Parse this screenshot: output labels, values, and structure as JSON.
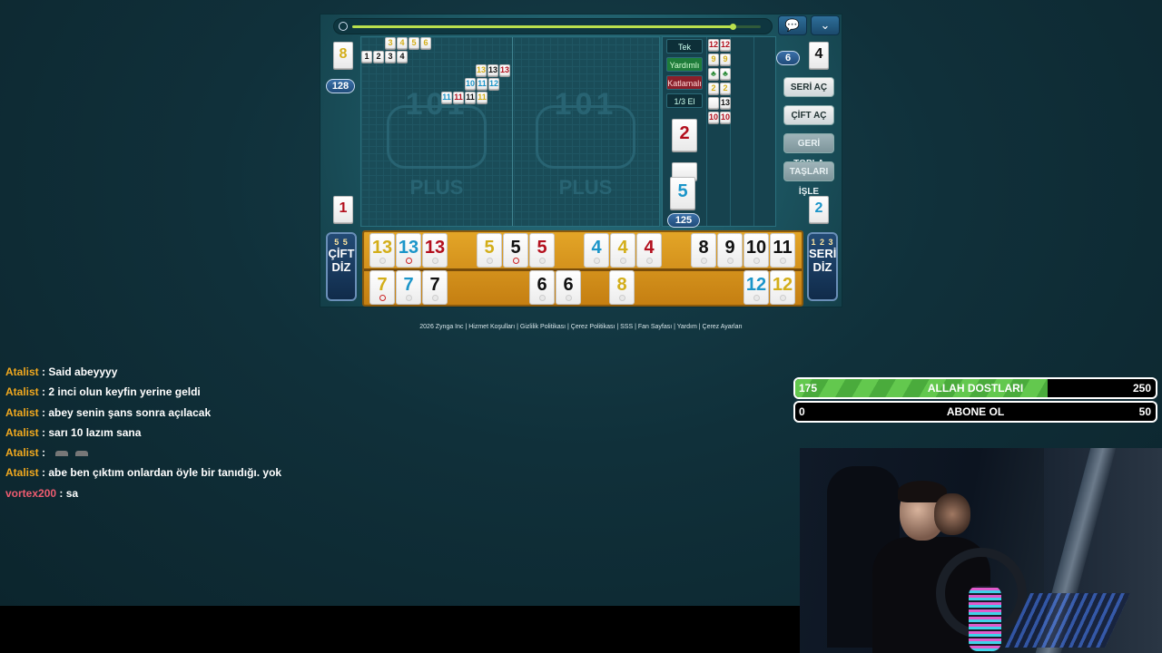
{
  "game": {
    "left_indicator_top": "8",
    "left_count": "128",
    "left_indicator_bottom": "1",
    "right_count": "6",
    "right_indicator_top": "4",
    "right_indicator_bottom": "2",
    "deck_count": "125",
    "discard_tile": "2",
    "held_tile": "5",
    "progress": 0.93,
    "logo_text": "101",
    "logo_sub": "PLUS",
    "indicators": [
      "Tek",
      "Yardımlı",
      "Katlamalı",
      "1/3 El"
    ],
    "buttons": {
      "seri_ac": "SERİ AÇ",
      "cift_ac": "ÇİFT AÇ",
      "geri_topla": "GERİ TOPLA",
      "taslari_isle": "TAŞLARI İŞLE",
      "cift_diz_1": "ÇİFT",
      "cift_diz_2": "DİZ",
      "seri_diz_1": "SERİ",
      "seri_diz_2": "DİZ",
      "cards_left": "5 5",
      "cards_right": "1 2 3"
    },
    "rack_top": [
      {
        "n": "13",
        "c": "y"
      },
      {
        "n": "13",
        "c": "b",
        "dot": true
      },
      {
        "n": "13",
        "c": "r"
      },
      {
        "n": "5",
        "c": "y"
      },
      {
        "n": "5",
        "c": "k",
        "dot": true
      },
      {
        "n": "5",
        "c": "r"
      },
      {
        "n": "4",
        "c": "b"
      },
      {
        "n": "4",
        "c": "y"
      },
      {
        "n": "4",
        "c": "r"
      },
      {
        "n": "8",
        "c": "k"
      },
      {
        "n": "9",
        "c": "k"
      },
      {
        "n": "10",
        "c": "k"
      },
      {
        "n": "11",
        "c": "k"
      }
    ],
    "rack_bottom": [
      {
        "n": "7",
        "c": "y",
        "dot": true
      },
      {
        "n": "7",
        "c": "b"
      },
      {
        "n": "7",
        "c": "k"
      },
      {
        "n": "6",
        "c": "k"
      },
      {
        "n": "6",
        "c": "k"
      },
      {
        "n": "8",
        "c": "y"
      },
      {
        "n": "12",
        "c": "b"
      },
      {
        "n": "12",
        "c": "y"
      }
    ],
    "table_sets": [
      [
        "3",
        "4",
        "5",
        "6"
      ],
      [
        "1",
        "2",
        "3",
        "4"
      ],
      [
        "13",
        "13",
        "13"
      ],
      [
        "10",
        "11",
        "12"
      ],
      [
        "11",
        "11",
        "11",
        "11"
      ]
    ],
    "discard_columns": [
      [
        "12",
        "9",
        "♣",
        "2",
        "",
        "10"
      ],
      [
        "12",
        "9",
        "♣",
        "2",
        "13",
        "10"
      ]
    ]
  },
  "footer": "2026 Zynga Inc | Hizmet Koşulları | Gizlilik Politikası | Çerez Politikası | SSS | Fan Sayfası | Yardım | Çerez Ayarları",
  "chat": [
    {
      "user": "Atalist",
      "text": "Said abeyyyy"
    },
    {
      "user": "Atalist",
      "text": "2 inci olun keyfin yerine geldi"
    },
    {
      "user": "Atalist",
      "text": "abey senin şans sonra açılacak"
    },
    {
      "user": "Atalist",
      "text": "sarı 10 lazım sana"
    },
    {
      "user": "Atalist",
      "text": ""
    },
    {
      "user": "Atalist",
      "text": "abe ben çıktım onlardan öyle bir tanıdığı. yok"
    },
    {
      "user": "vortex200",
      "text": "sa"
    }
  ],
  "goals": [
    {
      "left": "175",
      "title": "ALLAH DOSTLARI",
      "right": "250",
      "fill": 0.7
    },
    {
      "left": "0",
      "title": "ABONE OL",
      "right": "50",
      "fill": 0
    }
  ]
}
